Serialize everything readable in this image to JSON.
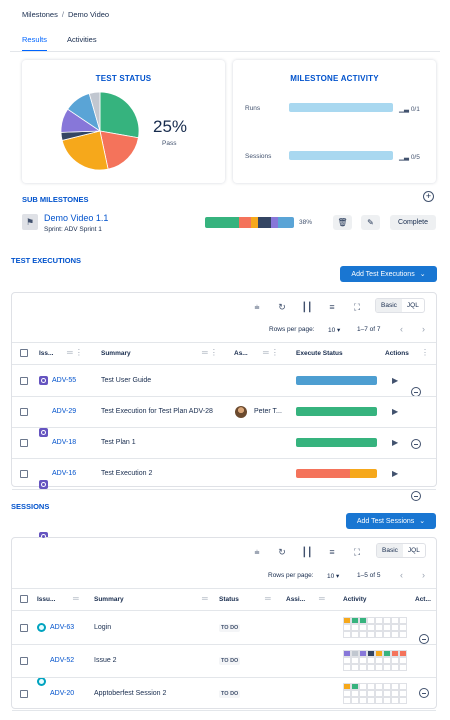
{
  "breadcrumb": {
    "parent": "Milestones",
    "separator": "/",
    "current": "Demo Video"
  },
  "tabs": [
    {
      "label": "Results",
      "active": true
    },
    {
      "label": "Activities",
      "active": false
    }
  ],
  "test_status": {
    "title": "TEST STATUS",
    "percent": "25%",
    "percent_label": "Pass",
    "pie": [
      {
        "color": "#36b37e",
        "value": 25
      },
      {
        "color": "#f4735b",
        "value": 17
      },
      {
        "color": "#f6a81b",
        "value": 22
      },
      {
        "color": "#344563",
        "value": 3
      },
      {
        "color": "#8777d9",
        "value": 9
      },
      {
        "color": "#5aa4d6",
        "value": 10
      },
      {
        "color": "#c1c7d0",
        "value": 4
      }
    ]
  },
  "milestone_activity": {
    "title": "MILESTONE ACTIVITY",
    "rows": [
      {
        "label": "Runs",
        "count": "0/1"
      },
      {
        "label": "Sessions",
        "count": "0/5"
      }
    ]
  },
  "sub_milestones": {
    "title": "SUB MILESTONES",
    "add_label": "+",
    "item": {
      "name": "Demo Video 1.1",
      "sprint": "Sprint: ADV Sprint 1",
      "percent": "38%",
      "progress": [
        {
          "color": "#36b37e",
          "value": 38
        },
        {
          "color": "#f4735b",
          "value": 14
        },
        {
          "color": "#f6a81b",
          "value": 8
        },
        {
          "color": "#344563",
          "value": 14
        },
        {
          "color": "#8777d9",
          "value": 8
        },
        {
          "color": "#5aa4d6",
          "value": 18
        }
      ],
      "complete_label": "Complete"
    }
  },
  "test_executions": {
    "title": "TEST EXECUTIONS",
    "add_button": "Add Test Executions",
    "toggle": [
      "Basic",
      "JQL"
    ],
    "rows_per_page_label": "Rows per page:",
    "rows_per_page": "10",
    "range": "1–7 of 7",
    "columns": [
      "Iss...",
      "Summary",
      "As...",
      "Execute Status",
      "Actions"
    ],
    "rows": [
      {
        "key": "ADV-55",
        "summary": "Test User Guide",
        "assignee": "",
        "status": [
          {
            "color": "#4d9ed1",
            "value": 100
          }
        ]
      },
      {
        "key": "ADV-29",
        "summary": "Test Execution for Test Plan ADV-28",
        "assignee": "Peter T...",
        "status": [
          {
            "color": "#36b37e",
            "value": 100
          }
        ]
      },
      {
        "key": "ADV-18",
        "summary": "Test Plan 1",
        "assignee": "",
        "status": [
          {
            "color": "#36b37e",
            "value": 100
          }
        ]
      },
      {
        "key": "ADV-16",
        "summary": "Test Execution 2",
        "assignee": "",
        "status": [
          {
            "color": "#f4735b",
            "value": 67
          },
          {
            "color": "#f6a81b",
            "value": 33
          }
        ]
      }
    ]
  },
  "sessions": {
    "title": "SESSIONS",
    "add_button": "Add Test Sessions",
    "toggle": [
      "Basic",
      "JQL"
    ],
    "rows_per_page_label": "Rows per page:",
    "rows_per_page": "10",
    "range": "1–5 of 5",
    "columns": [
      "Issu...",
      "Summary",
      "Status",
      "Assi...",
      "Activity",
      "Act..."
    ],
    "rows": [
      {
        "key": "ADV-63",
        "summary": "Login",
        "status": "TO DO",
        "activity": [
          "#f6a81b",
          "#36b37e",
          "#36b37e"
        ]
      },
      {
        "key": "ADV-52",
        "summary": "Issue 2",
        "status": "TO DO",
        "activity": [
          "#8777d9",
          "#c1c7d0",
          "#8777d9",
          "#344563",
          "#f6a81b",
          "#36b37e",
          "#f4735b",
          "#f4735b"
        ]
      },
      {
        "key": "ADV-20",
        "summary": "Apptoberfest Session 2",
        "status": "TO DO",
        "activity": [
          "#f6a81b",
          "#36b37e"
        ]
      }
    ]
  }
}
